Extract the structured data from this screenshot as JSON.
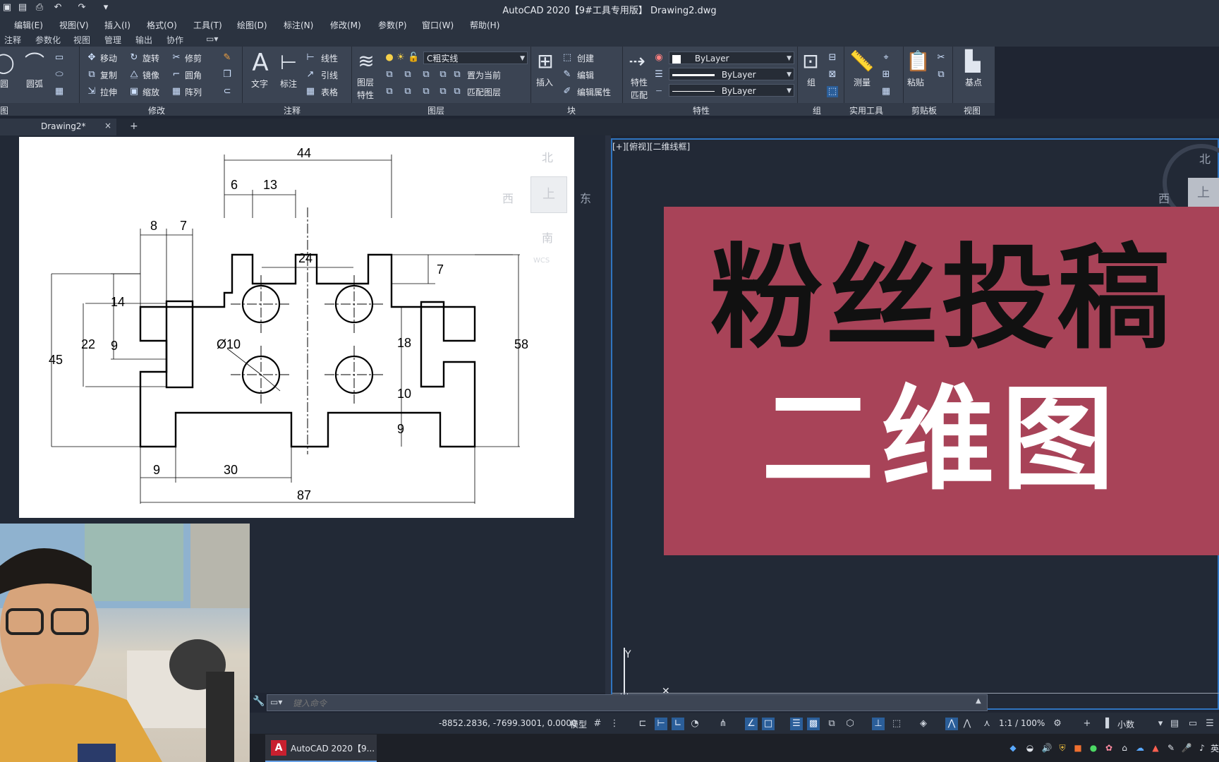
{
  "window": {
    "title": "AutoCAD 2020【9#工具专用版】    Drawing2.dwg"
  },
  "quick_access": [
    "save-icon",
    "save-as-icon",
    "print-icon",
    "undo-icon",
    "redo-icon",
    "customize-icon"
  ],
  "menu": {
    "items": [
      "编辑(E)",
      "视图(V)",
      "插入(I)",
      "格式(O)",
      "工具(T)",
      "绘图(D)",
      "标注(N)",
      "修改(M)",
      "参数(P)",
      "窗口(W)",
      "帮助(H)"
    ]
  },
  "ribbon_tabs": [
    "注释",
    "参数化",
    "视图",
    "管理",
    "输出",
    "协作"
  ],
  "ribbon": {
    "draw": {
      "circle": "圆",
      "arc": "圆弧",
      "title": "图"
    },
    "modify": {
      "title": "修改",
      "move": "移动",
      "rotate": "旋转",
      "trim": "修剪",
      "copy": "复制",
      "mirror": "镜像",
      "fillet": "圆角",
      "stretch": "拉伸",
      "scale": "缩放",
      "array": "阵列"
    },
    "annotation": {
      "title": "注释",
      "text": "文字",
      "dimension": "标注",
      "linear": "线性",
      "leader": "引线",
      "table": "表格"
    },
    "layers": {
      "title": "图层",
      "properties_l1": "图层",
      "properties_l2": "特性",
      "current_layer": "C粗实线",
      "make_current": "置为当前",
      "match_layer": "匹配图层"
    },
    "block": {
      "title": "块",
      "insert": "插入",
      "create": "创建",
      "edit": "编辑",
      "edit_attributes": "编辑属性"
    },
    "properties": {
      "title": "特性",
      "match_l1": "特性",
      "match_l2": "匹配",
      "color": "ByLayer",
      "lineweight": "ByLayer",
      "linetype": "ByLayer"
    },
    "groups": {
      "title": "组",
      "group": "组"
    },
    "utilities": {
      "title": "实用工具",
      "measure": "测量"
    },
    "clipboard": {
      "title": "剪贴板",
      "paste": "粘贴"
    },
    "view": {
      "title": "视图",
      "base": "基点"
    }
  },
  "doc_tab": {
    "name": "Drawing2*",
    "close": "×",
    "new": "+"
  },
  "left_viewport": {
    "compass": {
      "north": "北",
      "south": "南",
      "east": "东",
      "west": "西",
      "top": "上",
      "wcs": "WCS"
    }
  },
  "drawing_dims": {
    "d44": "44",
    "d6": "6",
    "d13": "13",
    "d8": "8",
    "d7a": "7",
    "d7b": "7",
    "d24": "24",
    "d14": "14",
    "d22": "22",
    "d9a": "9",
    "d45": "45",
    "d10dia": "Ø10",
    "d18": "18",
    "d10": "10",
    "d9b": "9",
    "d58": "58",
    "d9c": "9",
    "d30": "30",
    "d87": "87"
  },
  "right_viewport": {
    "label": "[+][俯视][二维线框]",
    "compass": {
      "north": "北",
      "west": "西",
      "top": "上"
    },
    "ucs_y": "Y"
  },
  "promo": {
    "line1": "粉丝投稿",
    "line2": "二维图",
    "line1_color": "#111111",
    "line2_color": "#ffffff",
    "background": "#a84358"
  },
  "command": {
    "placeholder": "键入命令"
  },
  "status": {
    "coords": "-8852.2836, -7699.3001, 0.0000",
    "model": "模型",
    "scale": "1:1 / 100%",
    "units": "小数"
  },
  "taskbar": {
    "app_label": "AutoCAD 2020【9...",
    "ime": "英"
  },
  "colors": {
    "accent": "#2f74c0",
    "ribbon_bg": "#3b4453",
    "canvas_bg": "#222936"
  }
}
